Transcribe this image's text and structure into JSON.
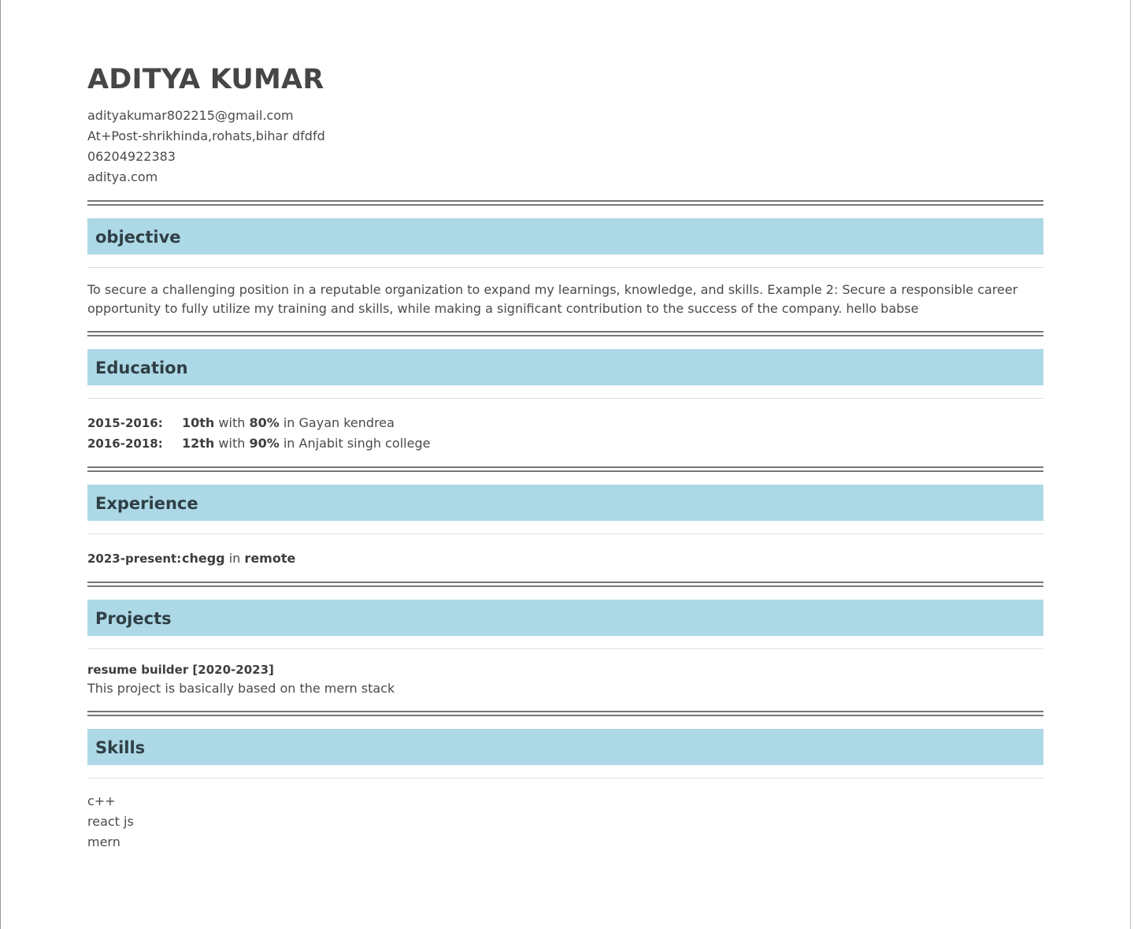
{
  "header": {
    "name": "ADITYA KUMAR",
    "email": "adityakumar802215@gmail.com",
    "address": "At+Post-shrikhinda,rohats,bihar dfdfd",
    "phone": "06204922383",
    "website": "aditya.com"
  },
  "objective": {
    "title": "objective",
    "text": "To secure a challenging position in a reputable organization to expand my learnings, knowledge, and skills. Example 2: Secure a responsible career opportunity to fully utilize my training and skills, while making a significant contribution to the success of the company. hello babse"
  },
  "education": {
    "title": "Education",
    "items": [
      {
        "date": "2015-2016:",
        "level": "10th",
        "with": "with",
        "score": "80%",
        "in": "in",
        "school": "Gayan kendrea"
      },
      {
        "date": "2016-2018:",
        "level": "12th",
        "with": "with",
        "score": "90%",
        "in": "in",
        "school": "Anjabit singh college"
      }
    ]
  },
  "experience": {
    "title": "Experience",
    "items": [
      {
        "date": "2023-present:",
        "company": "chegg",
        "in": "in",
        "location": "remote"
      }
    ]
  },
  "projects": {
    "title": "Projects",
    "items": [
      {
        "title": "resume builder [2020-2023]",
        "description": "This project is basically based on the mern stack"
      }
    ]
  },
  "skills": {
    "title": "Skills",
    "items": [
      "c++",
      "react js",
      "mern"
    ]
  },
  "colors": {
    "section_header_bg": "#add8e6",
    "text": "#4a4a4a",
    "rule": "#777777"
  }
}
